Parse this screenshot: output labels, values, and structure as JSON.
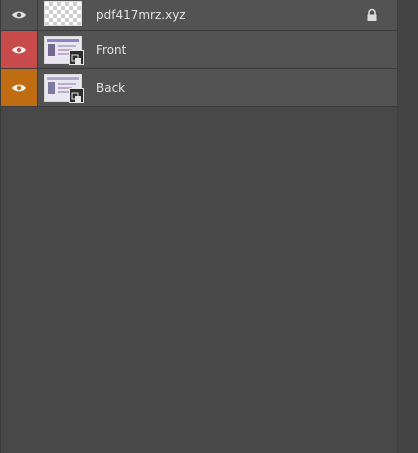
{
  "layers": [
    {
      "name": "pdf417mrz.xyz",
      "visible_color": "",
      "thumbnail": "transparent",
      "locked": true,
      "eye_icon": "eye-icon"
    },
    {
      "name": "Front",
      "visible_color": "#c94a4a",
      "thumbnail": "smart-object",
      "locked": false,
      "eye_icon": "eye-icon"
    },
    {
      "name": "Back",
      "visible_color": "#bf6c12",
      "thumbnail": "smart-object",
      "locked": false,
      "eye_icon": "eye-icon"
    }
  ],
  "colors": {
    "panel_bg": "#484848",
    "row_bg": "#535353",
    "text": "#e2e2e2",
    "front_label": "#c94a4a",
    "back_label": "#bf6c12"
  }
}
